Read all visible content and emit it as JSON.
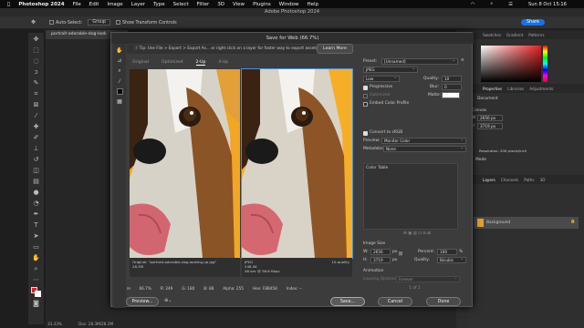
{
  "menubar": {
    "app": "Photoshop 2024",
    "items": [
      "File",
      "Edit",
      "Image",
      "Layer",
      "Type",
      "Select",
      "Filter",
      "3D",
      "View",
      "Plugins",
      "Window",
      "Help"
    ],
    "clock": "Sun 8 Oct 15:16"
  },
  "ps_title": "Adobe Photoshop 2024",
  "options_bar": {
    "auto_select": "Auto-Select:",
    "group": "Group",
    "transform": "Show Transform Controls",
    "share": "Share"
  },
  "doc_tab": "portrait-adorable-dog-look",
  "right_panel": {
    "tabs_top": [
      "Swatches",
      "Gradient",
      "Patterns"
    ],
    "tabs_mid": [
      "Properties",
      "Libraries",
      "Adjustments"
    ],
    "document": "Document",
    "canvas": "Canvas",
    "w": "2656 px",
    "h": "3719 px",
    "resolution": "Resolution: 200 pixels/inch",
    "mode": "Mode",
    "layers_tabs": [
      "Layers",
      "Channels",
      "Paths",
      "3D"
    ],
    "layer_name": "Background"
  },
  "statusbar": {
    "zoom": "33.33%",
    "doc": "Doc: 28.3M/28.3M"
  },
  "dialog": {
    "title": "Save for Web (66.7%)",
    "tip": "Tip: Use File > Export > Export As...  or right click on a layer for faster way to export assets",
    "learn_more": "Learn More",
    "view_tabs": [
      "Original",
      "Optimized",
      "2-Up",
      "4-Up"
    ],
    "active_tab": "2-Up",
    "caption_left": {
      "line1": "Original: \"portrait-adorable-dog-looking-up.jpg\"",
      "line2": "28.3M"
    },
    "caption_right": {
      "line1": "JPEG",
      "line2": "248.4K",
      "line3": "46 sec @ 56.6 Kbps",
      "quality": "10 quality"
    },
    "bottom": {
      "zoom": "66.7%",
      "r": "R: 249",
      "g": "G: 180",
      "b": "B: 88",
      "alpha": "Alpha: 255",
      "hex": "Hex: F8B458",
      "index": "Index: --"
    },
    "buttons": {
      "preview": "Preview...",
      "save": "Save...",
      "cancel": "Cancel",
      "done": "Done"
    },
    "settings": {
      "preset_label": "Preset:",
      "preset_value": "[Unnamed]",
      "format": "JPEG",
      "quality_level": "Low",
      "quality_label": "Quality:",
      "quality_value": "10",
      "progressive": "Progressive",
      "blur_label": "Blur:",
      "blur_value": "0",
      "optimized": "Optimized",
      "matte_label": "Matte:",
      "embed_profile": "Embed Color Profile",
      "convert_srgb": "Convert to sRGB",
      "preview_label": "Preview:",
      "preview_value": "Monitor Color",
      "metadata_label": "Metadata:",
      "metadata_value": "None",
      "color_table": "Color Table",
      "image_size": "Image Size",
      "w_label": "W:",
      "w_value": "2656",
      "h_label": "H:",
      "h_value": "3719",
      "px": "px",
      "percent_label": "Percent:",
      "percent_value": "100",
      "percent_unit": "%",
      "quality2_label": "Quality:",
      "quality2_value": "Bicubic",
      "animation": "Animation",
      "looping_label": "Looping Options:",
      "looping_value": "Forever",
      "frame": "1 of 1"
    }
  }
}
